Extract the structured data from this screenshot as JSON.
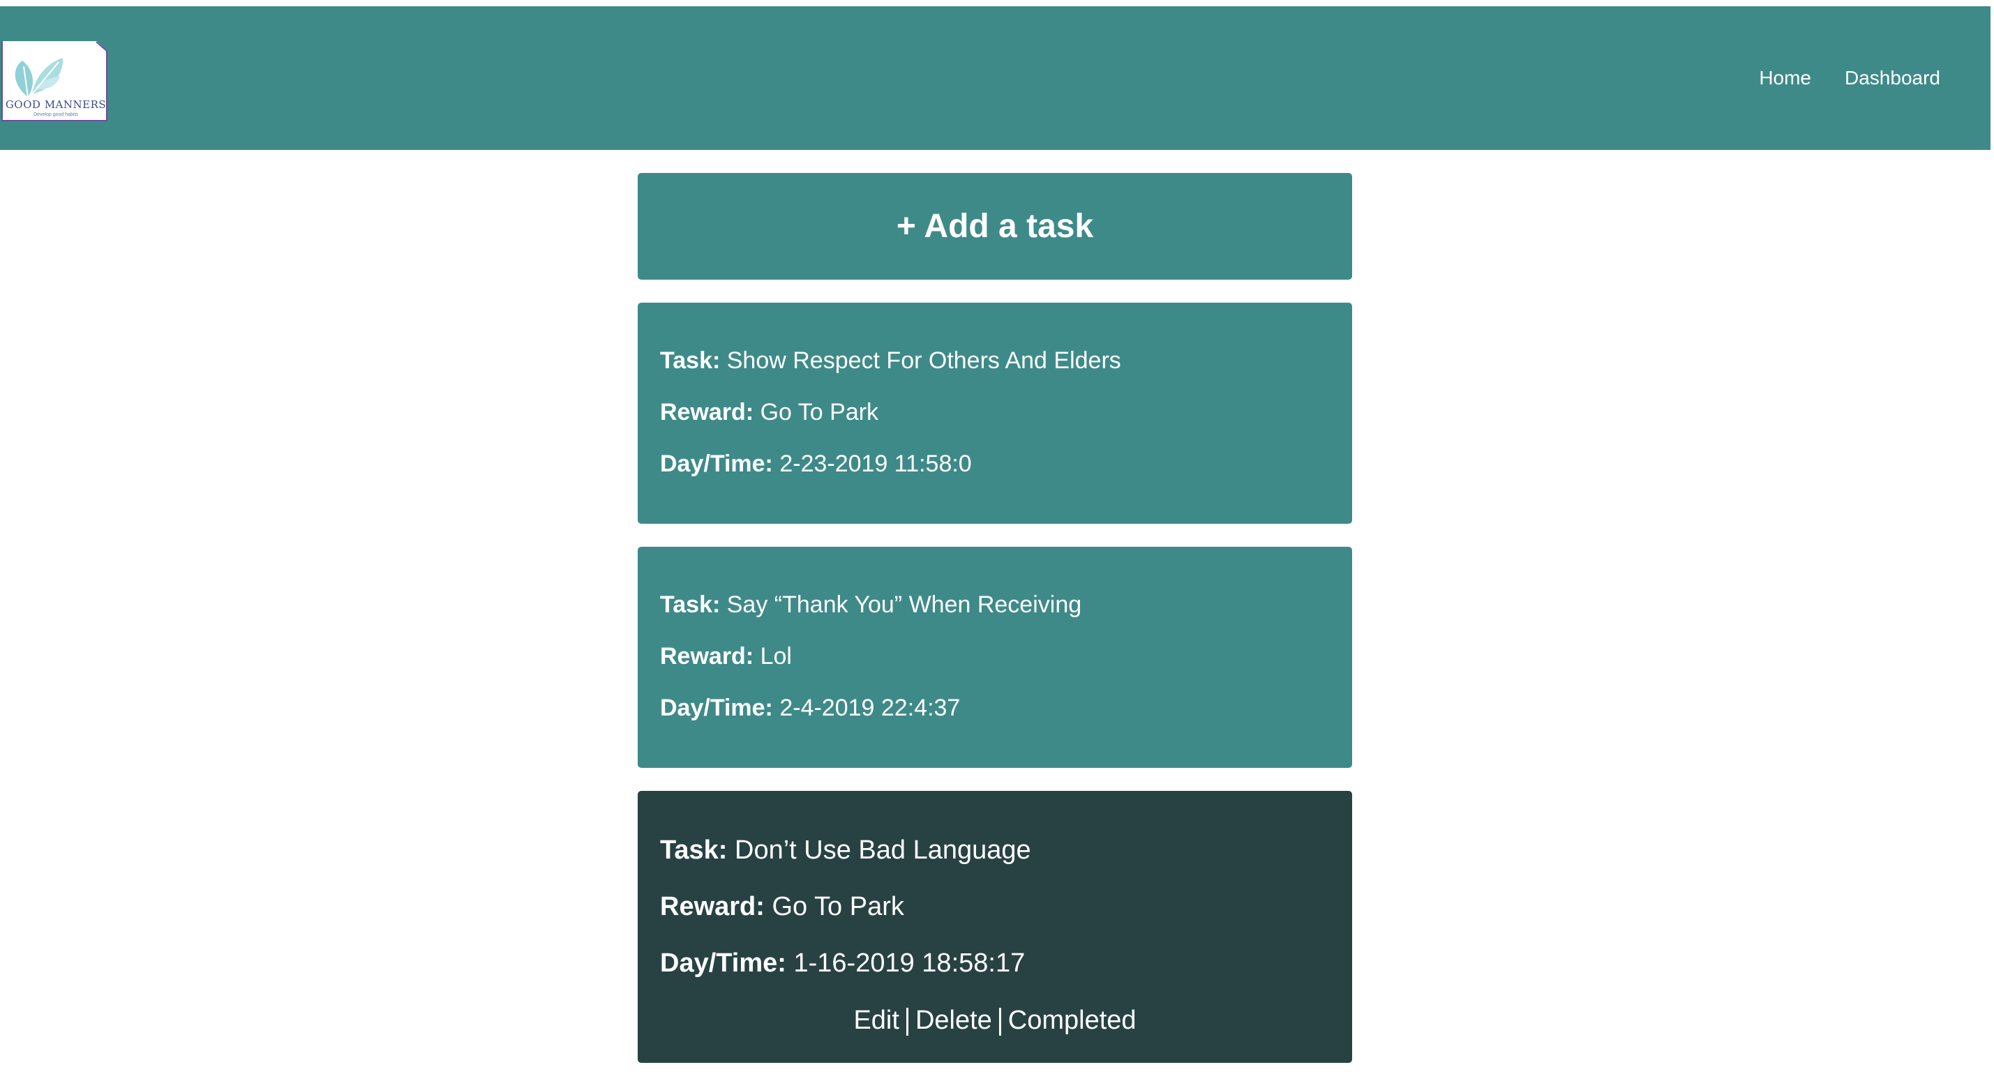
{
  "header": {
    "logo": {
      "brand": "GOOD MANNERS",
      "tagline": "Develop good habits"
    },
    "nav": [
      {
        "label": "Home"
      },
      {
        "label": "Dashboard"
      }
    ]
  },
  "main": {
    "add_task_label": "+ Add a task",
    "labels": {
      "task": "Task:",
      "reward": "Reward:",
      "daytime": "Day/Time:"
    },
    "tasks": [
      {
        "task": "Show Respect For Others And Elders",
        "reward": "Go To Park",
        "daytime": "2-23-2019 11:58:0",
        "selected": false
      },
      {
        "task": "Say “Thank You” When Receiving",
        "reward": "Lol",
        "daytime": "2-4-2019 22:4:37",
        "selected": false
      },
      {
        "task": "Don’t Use Bad Language",
        "reward": "Go To Park",
        "daytime": "1-16-2019 18:58:17",
        "selected": true,
        "actions": [
          {
            "label": "Edit"
          },
          {
            "label": "Delete"
          },
          {
            "label": "Completed"
          }
        ]
      }
    ]
  },
  "colors": {
    "primary": "#3e8a89",
    "selected_card": "#284244",
    "text": "#ffffff"
  }
}
